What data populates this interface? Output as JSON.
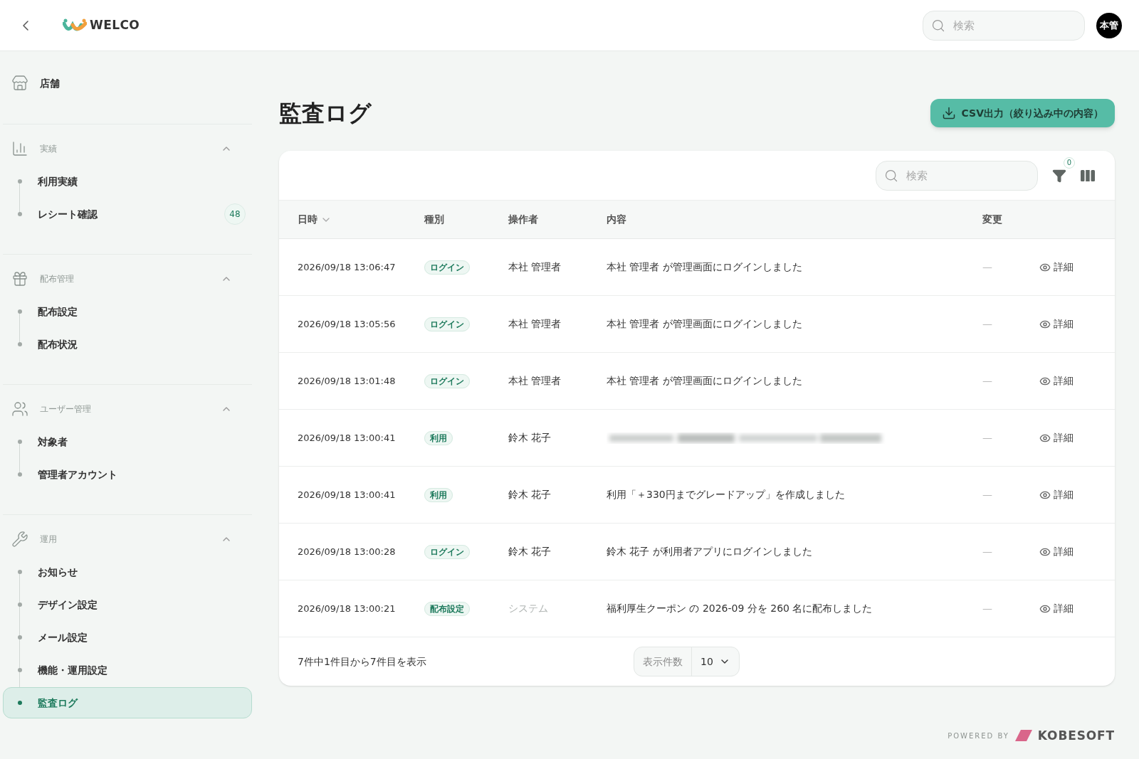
{
  "header": {
    "logo": "WELCO",
    "search": {
      "placeholder": "検索"
    },
    "avatar": "本管"
  },
  "sidebar": {
    "items": [
      {
        "label": "店舗"
      }
    ],
    "sections": [
      {
        "title": "実績",
        "expanded": true,
        "items": [
          {
            "label": "利用実績",
            "selected": false
          },
          {
            "label": "レシート確認",
            "badge": "48",
            "selected": false
          }
        ]
      },
      {
        "title": "配布管理",
        "expanded": true,
        "items": [
          {
            "label": "配布設定",
            "selected": false
          },
          {
            "label": "配布状況",
            "selected": false
          }
        ]
      },
      {
        "title": "ユーザー管理",
        "expanded": true,
        "items": [
          {
            "label": "対象者",
            "selected": false
          },
          {
            "label": "管理者アカウント",
            "selected": false
          }
        ]
      },
      {
        "title": "運用",
        "expanded": true,
        "items": [
          {
            "label": "お知らせ",
            "selected": false
          },
          {
            "label": "デザイン設定",
            "selected": false
          },
          {
            "label": "メール設定",
            "selected": false
          },
          {
            "label": "機能・運用設定",
            "selected": false
          },
          {
            "label": "監査ログ",
            "selected": true
          }
        ]
      }
    ]
  },
  "page": {
    "title": "監査ログ",
    "export_button": "CSV出力（絞り込み中の内容）"
  },
  "table": {
    "search": {
      "placeholder": "検索"
    },
    "filter_count": "0",
    "columns": [
      {
        "label": "日時",
        "sorted": true
      },
      {
        "label": "種別",
        "sorted": false
      },
      {
        "label": "操作者",
        "sorted": false
      },
      {
        "label": "内容",
        "sorted": false
      },
      {
        "label": "変更",
        "sorted": false
      }
    ],
    "rows": [
      {
        "datetime": "2026/09/18 13:06:47",
        "type": "ログイン",
        "operator": "本社 管理者",
        "system": false,
        "blurred": false,
        "content": "本社 管理者 が管理画面にログインしました",
        "change": "—",
        "action": "詳細"
      },
      {
        "datetime": "2026/09/18 13:05:56",
        "type": "ログイン",
        "operator": "本社 管理者",
        "system": false,
        "blurred": false,
        "content": "本社 管理者 が管理画面にログインしました",
        "change": "—",
        "action": "詳細"
      },
      {
        "datetime": "2026/09/18 13:01:48",
        "type": "ログイン",
        "operator": "本社 管理者",
        "system": false,
        "blurred": false,
        "content": "本社 管理者 が管理画面にログインしました",
        "change": "—",
        "action": "詳細"
      },
      {
        "datetime": "2026/09/18 13:00:41",
        "type": "利用",
        "operator": "鈴木 花子",
        "system": false,
        "blurred": true,
        "change": "—",
        "action": "詳細"
      },
      {
        "datetime": "2026/09/18 13:00:41",
        "type": "利用",
        "operator": "鈴木 花子",
        "system": false,
        "blurred": false,
        "content": "利用「＋330円までグレードアップ」を作成しました",
        "change": "—",
        "action": "詳細"
      },
      {
        "datetime": "2026/09/18 13:00:28",
        "type": "ログイン",
        "operator": "鈴木 花子",
        "system": false,
        "blurred": false,
        "content": "鈴木 花子 が利用者アプリにログインしました",
        "change": "—",
        "action": "詳細"
      },
      {
        "datetime": "2026/09/18 13:00:21",
        "type": "配布設定",
        "operator": "システム",
        "system": true,
        "blurred": false,
        "content": "福利厚生クーポン の 2026-09 分を 260 名に配布しました",
        "change": "—",
        "action": "詳細"
      }
    ],
    "footer": {
      "summary": "7件中1件目から7件目を表示",
      "page_size_label": "表示件数",
      "page_size": "10"
    }
  },
  "powered": {
    "label": "POWERED BY",
    "brand": "KOBESOFT"
  }
}
